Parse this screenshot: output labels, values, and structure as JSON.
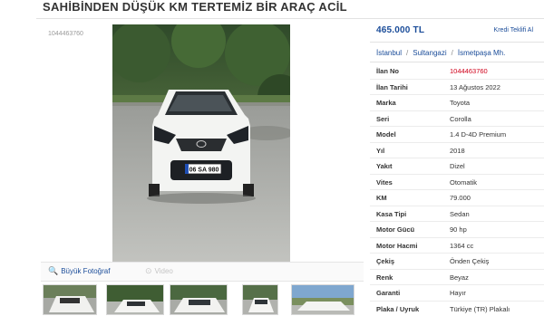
{
  "listing": {
    "title": "SAHİBİNDEN DÜŞÜK KM TERTEMİZ BİR ARAÇ ACİL",
    "ad_id_small": "1044463760",
    "price": "465.000 TL",
    "credit_link": "Kredi Teklifi Al",
    "location": {
      "city": "İstanbul",
      "district": "Sultangazi",
      "neighborhood": "İsmetpaşa Mh."
    },
    "plate_text": "06 SA 980"
  },
  "media_toolbar": {
    "big_photo": "Büyük Fotoğraf",
    "video": "Video"
  },
  "specs": [
    {
      "label": "İlan No",
      "value": "1044463760",
      "highlight": true
    },
    {
      "label": "İlan Tarihi",
      "value": "13 Ağustos 2022"
    },
    {
      "label": "Marka",
      "value": "Toyota"
    },
    {
      "label": "Seri",
      "value": "Corolla"
    },
    {
      "label": "Model",
      "value": "1.4 D-4D Premium"
    },
    {
      "label": "Yıl",
      "value": "2018"
    },
    {
      "label": "Yakıt",
      "value": "Dizel"
    },
    {
      "label": "Vites",
      "value": "Otomatik"
    },
    {
      "label": "KM",
      "value": "79.000"
    },
    {
      "label": "Kasa Tipi",
      "value": "Sedan"
    },
    {
      "label": "Motor Gücü",
      "value": "90 hp"
    },
    {
      "label": "Motor Hacmi",
      "value": "1364 cc"
    },
    {
      "label": "Çekiş",
      "value": "Önden Çekiş"
    },
    {
      "label": "Renk",
      "value": "Beyaz"
    },
    {
      "label": "Garanti",
      "value": "Hayır"
    },
    {
      "label": "Plaka / Uyruk",
      "value": "Türkiye (TR) Plakalı"
    }
  ],
  "colors": {
    "link_blue": "#1a4c99",
    "highlight_red": "#d0021b"
  }
}
